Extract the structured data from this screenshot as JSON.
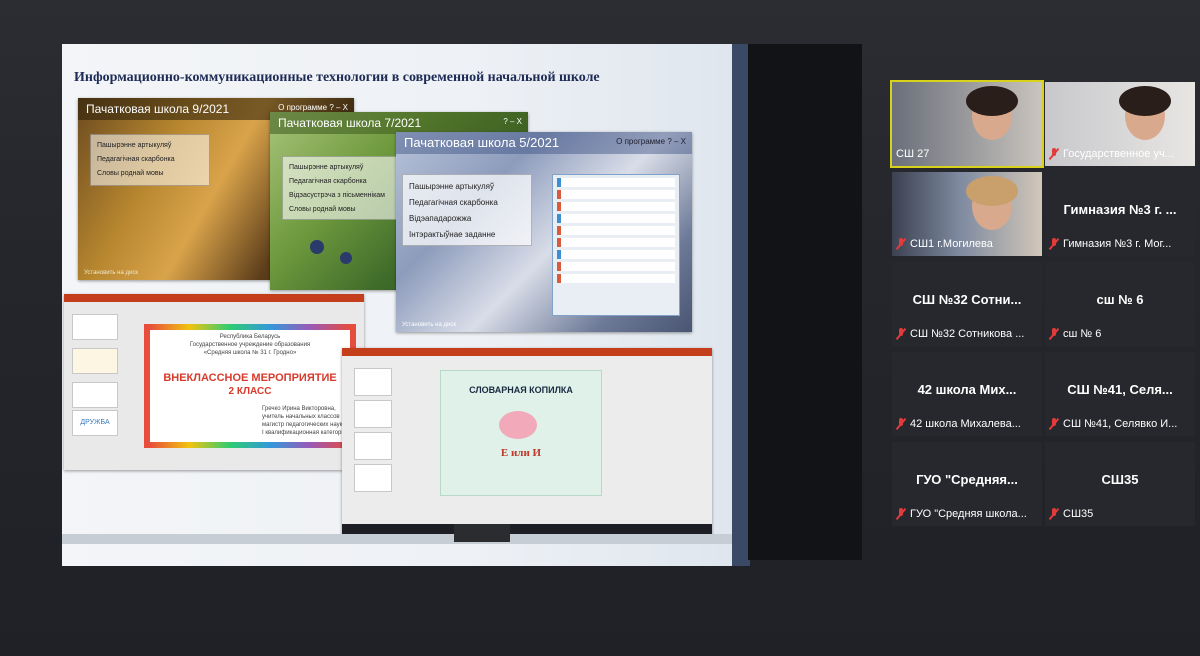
{
  "slide": {
    "title": "Информационно-коммуникационные технологии в современной начальной школе",
    "shot1": {
      "title": "Пачатковая школа 9/2021",
      "controls": "О программе  ?  –  X",
      "menu": [
        "Пашырэнне артыкуляў",
        "Педагагічная скарбонка",
        "Словы роднай мовы"
      ],
      "footer": "Установить на диск"
    },
    "shot2": {
      "title": "Пачатковая школа 7/2021",
      "controls": "?  –  X",
      "menu": [
        "Пашырэнне артыкуляў",
        "Педагагічная скарбонка",
        "Відэасустрэча з пісьменнікам",
        "Словы роднай мовы"
      ]
    },
    "shot3": {
      "title": "Пачатковая школа 5/2021",
      "controls": "О программе  ?  –  X",
      "menu": [
        "Пашырэнне артыкуляў",
        "Педагагічная скарбонка",
        "Відэападарожжа",
        "Інтэрактыўнае заданне"
      ],
      "footer": "Установить на диск"
    },
    "ppt1": {
      "line1": "Республика Беларусь",
      "line2": "Государственное учреждение образования",
      "line3": "«Средняя школа № 31 г. Гродно»",
      "heading": "ВНЕКЛАССНОЕ МЕРОПРИЯТИЕ",
      "subheading": "2 КЛАСС",
      "author": "Гречко Ирина Викторовна,",
      "author2": "учитель начальных классов",
      "author3": "магистр педагогических наук",
      "author4": "I квалификационная категория",
      "thumb_label": "ДРУЖБА"
    },
    "ppt2": {
      "heading": "СЛОВАРНАЯ КОПИЛКА",
      "answer": "Е или И"
    }
  },
  "participants": [
    {
      "center": "",
      "name": "СШ 27",
      "active": true,
      "video": true
    },
    {
      "center": "",
      "name": "Государственное уч...",
      "active": false,
      "video": true
    },
    {
      "center": "",
      "name": "СШ1 г.Могилева",
      "active": false,
      "video": true
    },
    {
      "center": "Гимназия №3 г. ...",
      "name": "Гимназия №3 г. Мог...",
      "active": false,
      "video": false
    },
    {
      "center": "СШ №32  Сотни...",
      "name": "СШ №32 Сотникова ...",
      "active": false,
      "video": false
    },
    {
      "center": "сш № 6",
      "name": "сш № 6",
      "active": false,
      "video": false
    },
    {
      "center": "42 школа  Мих...",
      "name": "42 школа  Михалева...",
      "active": false,
      "video": false
    },
    {
      "center": "СШ №41, Селя...",
      "name": "СШ №41, Селявко И...",
      "active": false,
      "video": false
    },
    {
      "center": "ГУО  \"Средняя...",
      "name": "ГУО \"Средняя школа...",
      "active": false,
      "video": false
    },
    {
      "center": "СШ35",
      "name": "СШ35",
      "active": false,
      "video": false
    }
  ],
  "colors": {
    "active_border": "#d8d21a",
    "mic_muted": "#e23b3b",
    "ppt_accent": "#c43e1c"
  }
}
